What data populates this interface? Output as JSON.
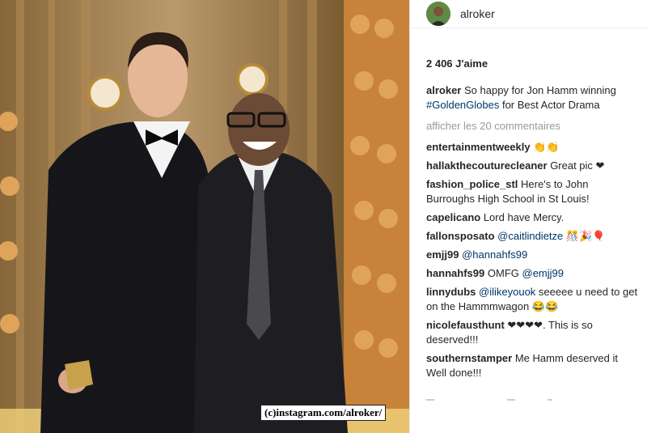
{
  "header": {
    "username": "alroker"
  },
  "likes": "2 406 J'aime",
  "caption": {
    "username": "alroker",
    "text_1": "So happy for Jon Hamm winning",
    "hashtag": "#GoldenGlobes",
    "text_2": "for Best Actor Drama"
  },
  "more_comments": "afficher les 20 commentaires",
  "comments": [
    {
      "user": "entertainmentweekly",
      "text": "👏👏"
    },
    {
      "user": "hallakthecouturecleaner",
      "text": "Great pic ❤"
    },
    {
      "user": "fashion_police_stl",
      "text": "Here's to John Burroughs High School in St Louis!"
    },
    {
      "user": "capelicano",
      "text": "Lord have Mercy."
    },
    {
      "user": "fallonsposato",
      "mention": "@caitlindietze",
      "text": "🎊🎉🎈"
    },
    {
      "user": "emjj99",
      "mention": "@hannahfs99",
      "text": ""
    },
    {
      "user": "hannahfs99",
      "text": "OMFG",
      "mention_after": "@emjj99"
    },
    {
      "user": "linnydubs",
      "mention": "@ilikeyouok",
      "text": "seeeee u need to get on the Hammmwagon 😂😂"
    },
    {
      "user": "nicolefausthunt",
      "text": "❤❤❤❤. This is so deserved!!!"
    },
    {
      "user": "southernstamper",
      "text": "Me Hamm deserved it Well done!!!"
    }
  ],
  "photo_credit": "(c)instagram.com/alroker/"
}
